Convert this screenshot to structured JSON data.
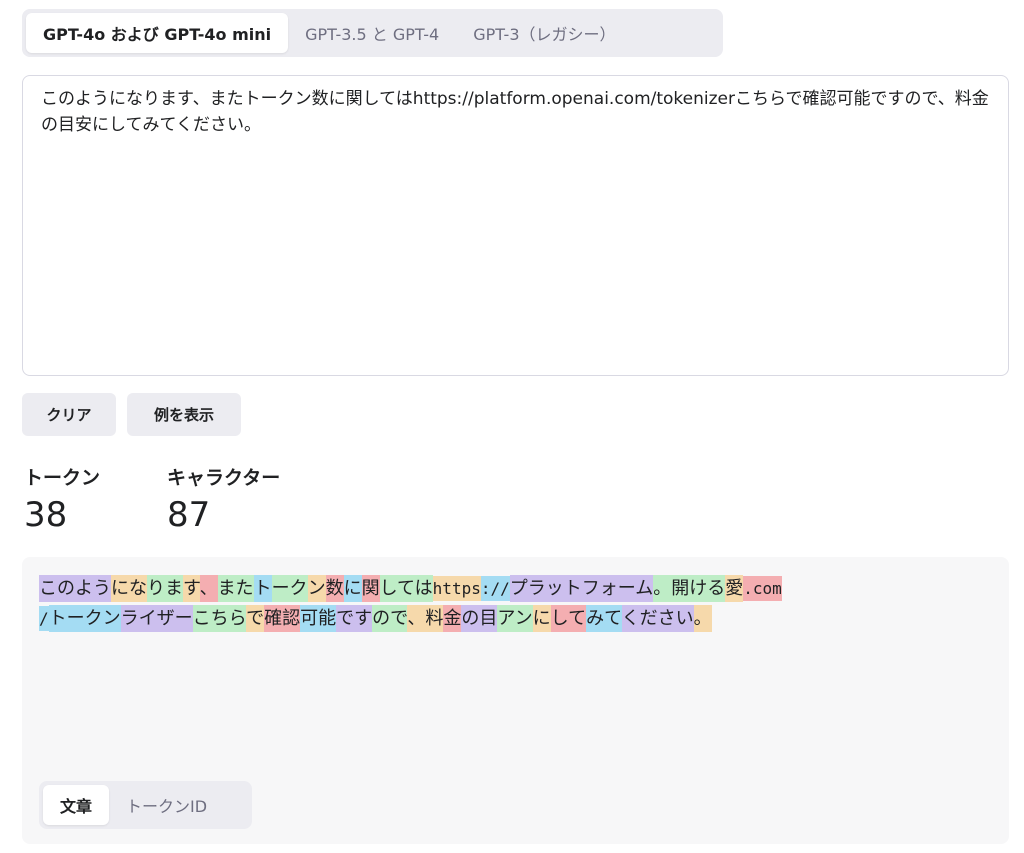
{
  "model_tabs": [
    {
      "label": "GPT-4o および GPT-4o mini",
      "active": true
    },
    {
      "label": "GPT-3.5 と GPT-4",
      "active": false
    },
    {
      "label": "GPT-3（レガシー）",
      "active": false
    }
  ],
  "input": {
    "value": "このようになります、またトークン数に関してはhttps://platform.openai.com/tokenizerこちらで確認可能ですので、料金の目安にしてみてください。"
  },
  "buttons": {
    "clear_label": "クリア",
    "example_label": "例を表示"
  },
  "stats": {
    "tokens_label": "トークン",
    "tokens_value": "38",
    "chars_label": "キャラクター",
    "chars_value": "87"
  },
  "tokens": [
    "このよう",
    "にな",
    "りま",
    "す",
    "、",
    "また",
    "ト",
    "ーク",
    "ン",
    "数",
    "に",
    "関",
    "しては",
    "https",
    "://",
    "プラットフォーム",
    "。開ける",
    "愛",
    ".com",
    "/",
    "トークン",
    "ライザー",
    "こちら",
    "で",
    "確",
    "認",
    "可能",
    "です",
    "ので",
    "、",
    "料",
    "金",
    "の目",
    "アン",
    "に",
    "して",
    "みて",
    "ください",
    "。"
  ],
  "token_colors": [
    "c0",
    "c2",
    "c1",
    "c2",
    "c3",
    "c1",
    "c4",
    "c1",
    "c2",
    "c3",
    "c4",
    "c3",
    "c1",
    "c2",
    "c4",
    "c0",
    "c1",
    "c2",
    "c3",
    "c4",
    "c4",
    "c0",
    "c1",
    "c2",
    "c3",
    "c3",
    "c4",
    "c0",
    "c1",
    "c2",
    "c2",
    "c3",
    "c0",
    "c1",
    "c2",
    "c3",
    "c4",
    "c0",
    "c2"
  ],
  "view_tabs": [
    {
      "label": "文章",
      "active": true
    },
    {
      "label": "トークンID",
      "active": false
    }
  ]
}
